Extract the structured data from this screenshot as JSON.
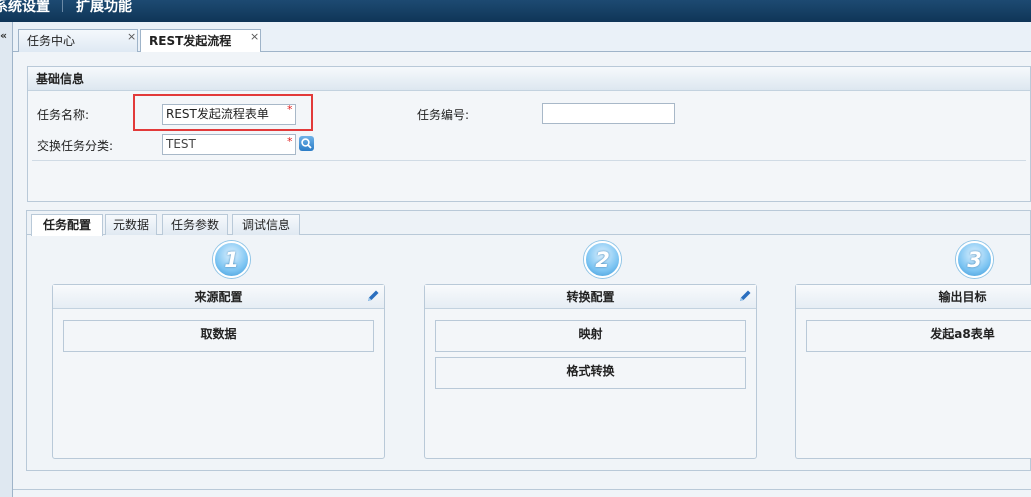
{
  "topbar": {
    "menu1": "系统设置",
    "menu2": "扩展功能"
  },
  "leftstrip": {
    "collapse_icon": "«"
  },
  "tabs": [
    {
      "label": "任务中心",
      "close": "×"
    },
    {
      "label": "REST发起流程",
      "close": "×"
    }
  ],
  "basic_info": {
    "title": "基础信息",
    "task_name_label": "任务名称:",
    "task_name_value": "REST发起流程表单",
    "task_no_label": "任务编号:",
    "task_no_value": "",
    "category_label": "交换任务分类:",
    "category_value": "TEST",
    "required_mark": "*"
  },
  "config_tabs": [
    "任务配置",
    "元数据",
    "任务参数",
    "调试信息"
  ],
  "steps": [
    {
      "num": "1",
      "title": "来源配置",
      "items": [
        "取数据"
      ]
    },
    {
      "num": "2",
      "title": "转换配置",
      "items": [
        "映射",
        "格式转换"
      ]
    },
    {
      "num": "3",
      "title": "输出目标",
      "items": [
        "发起a8表单"
      ]
    }
  ],
  "colors": {
    "topbar": "#0f3557",
    "highlight": "#e23a3a",
    "step": "#3a96d6",
    "pencil": "#2b6fbf"
  }
}
